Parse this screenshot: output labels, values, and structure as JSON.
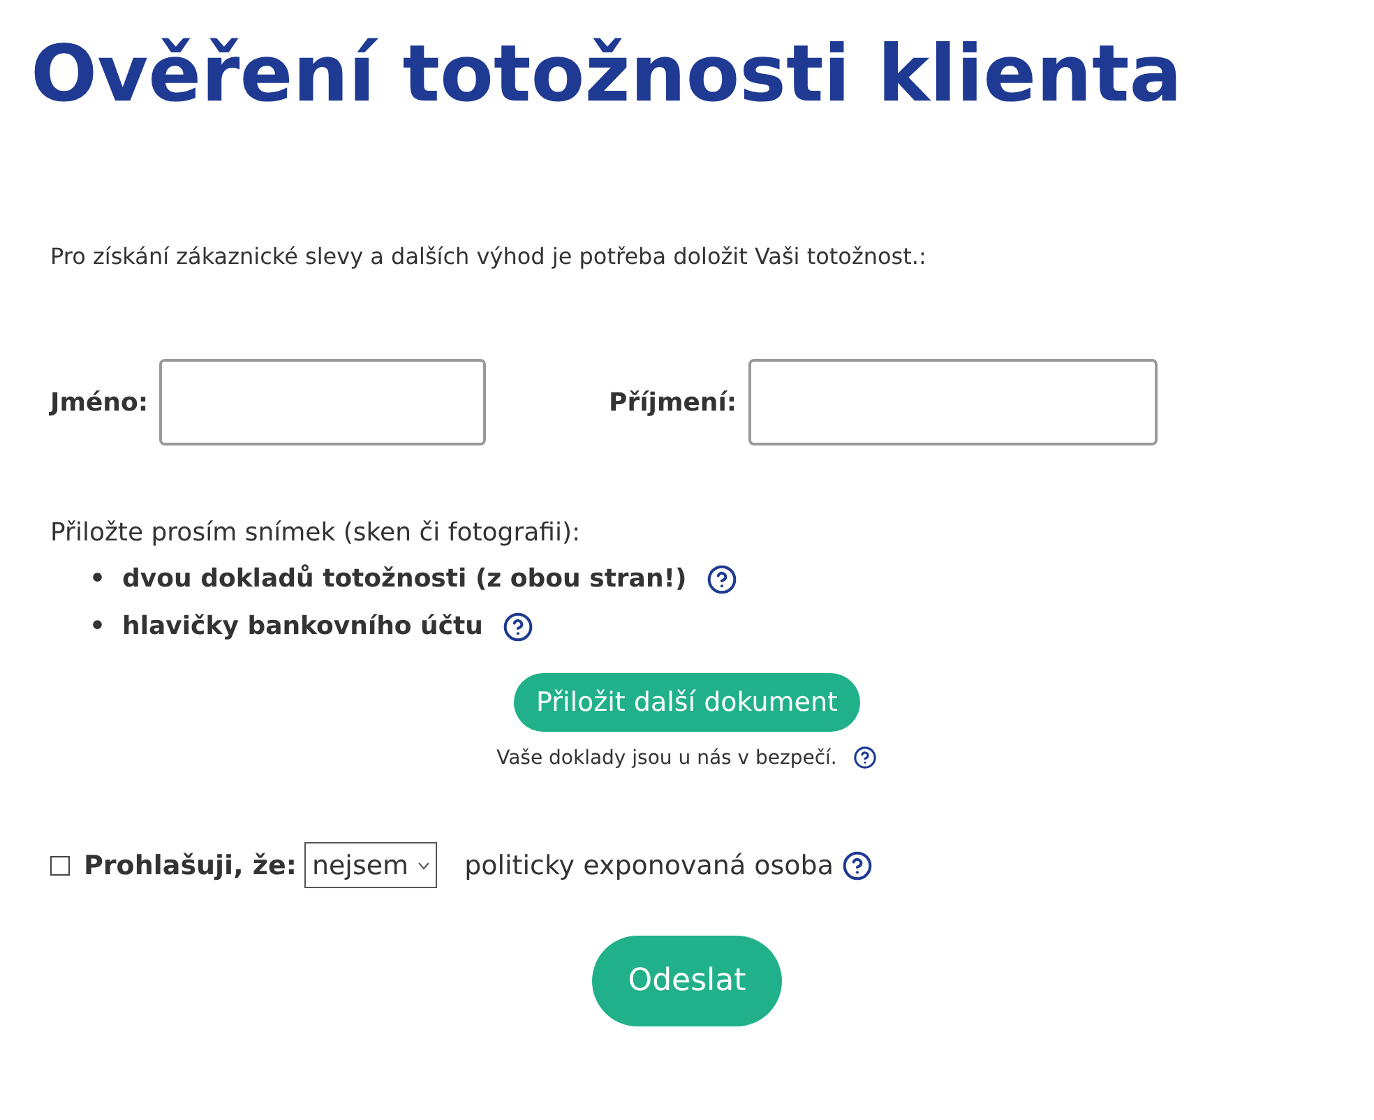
{
  "title": "Ověření totožnosti klienta",
  "intro": "Pro získání zákaznické slevy a dalších výhod je potřeba doložit Vaši totožnost.:",
  "fields": [
    {
      "label": "Jméno:"
    },
    {
      "label": "Příjmení:"
    }
  ],
  "attach_prompt": "Přiložte prosím snímek (sken či fotografii):",
  "documents": [
    {
      "bullet": "•",
      "text": "dvou dokladů totožnosti (z obou stran!)"
    },
    {
      "bullet": "•",
      "text": "hlavičky bankovního účtu"
    }
  ],
  "attach_button": "Přiložit další dokument",
  "safety_note": "Vaše doklady jsou u nás v bezpečí.",
  "declaration": {
    "checked": false,
    "label": "Prohlašuji, že:",
    "choice": "nejsem",
    "suffix": "politicky exponovaná osoba"
  },
  "submit_button": "Odeslat"
}
